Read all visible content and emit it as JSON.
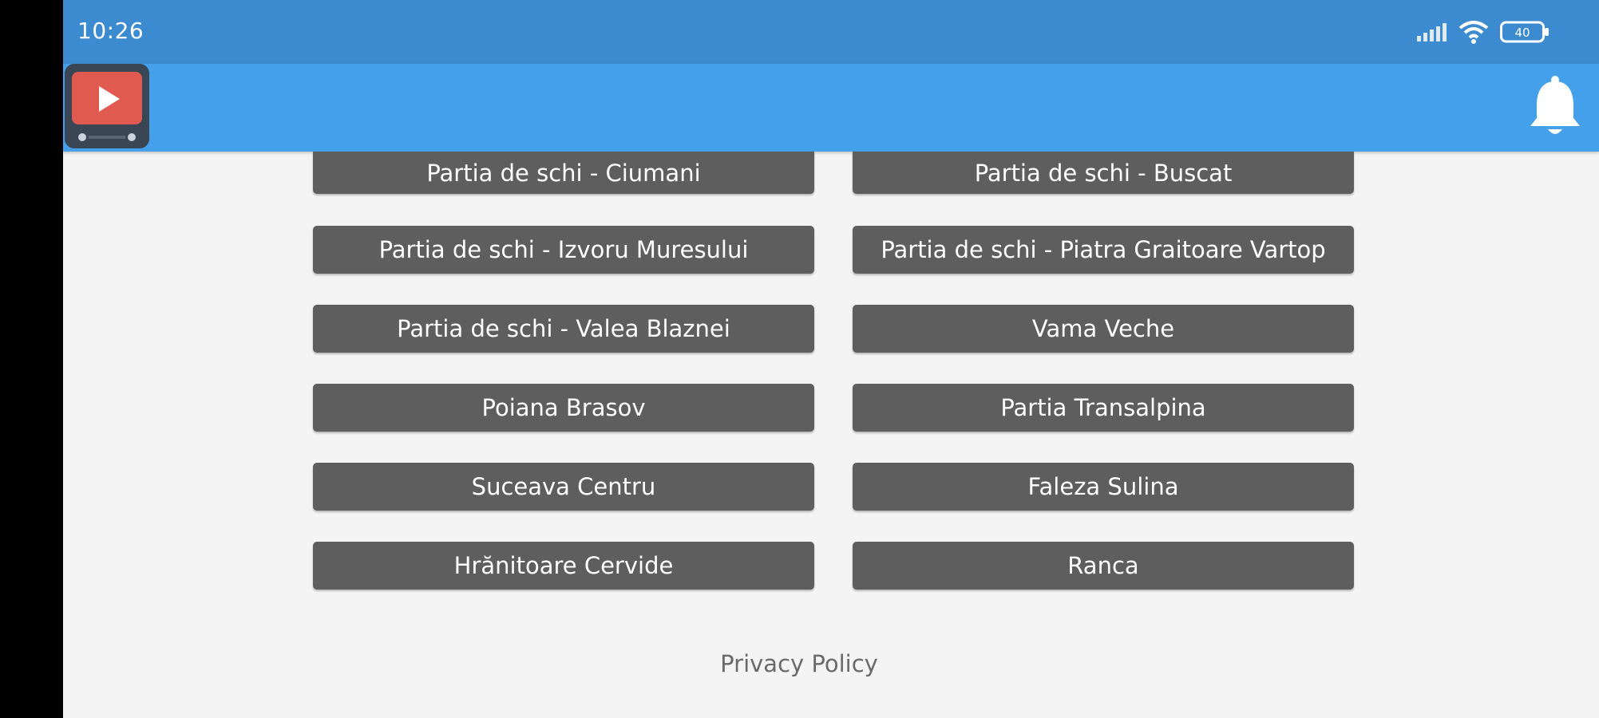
{
  "status_bar": {
    "time": "10:26",
    "battery_level": "40",
    "icons": [
      "signal-icon",
      "wifi-icon",
      "battery-icon"
    ]
  },
  "app_bar": {
    "logo_icon": "play-video-icon",
    "notification_icon": "bell-icon",
    "colors": {
      "status": "#3c8ad0",
      "bar": "#45a0eb",
      "logo": "#e05a4f"
    }
  },
  "locations": {
    "buttons": [
      {
        "label": "Partia de schi - Ciumani"
      },
      {
        "label": "Partia de schi - Buscat"
      },
      {
        "label": "Partia de schi - Izvoru Muresului"
      },
      {
        "label": "Partia de schi - Piatra Graitoare Vartop"
      },
      {
        "label": "Partia de schi - Valea Blaznei"
      },
      {
        "label": "Vama Veche"
      },
      {
        "label": "Poiana Brasov"
      },
      {
        "label": "Partia Transalpina"
      },
      {
        "label": "Suceava Centru"
      },
      {
        "label": "Faleza Sulina"
      },
      {
        "label": "Hrănitoare Cervide"
      },
      {
        "label": "Ranca"
      }
    ],
    "button_color": "#5e5e5e"
  },
  "footer": {
    "privacy_label": "Privacy Policy"
  }
}
